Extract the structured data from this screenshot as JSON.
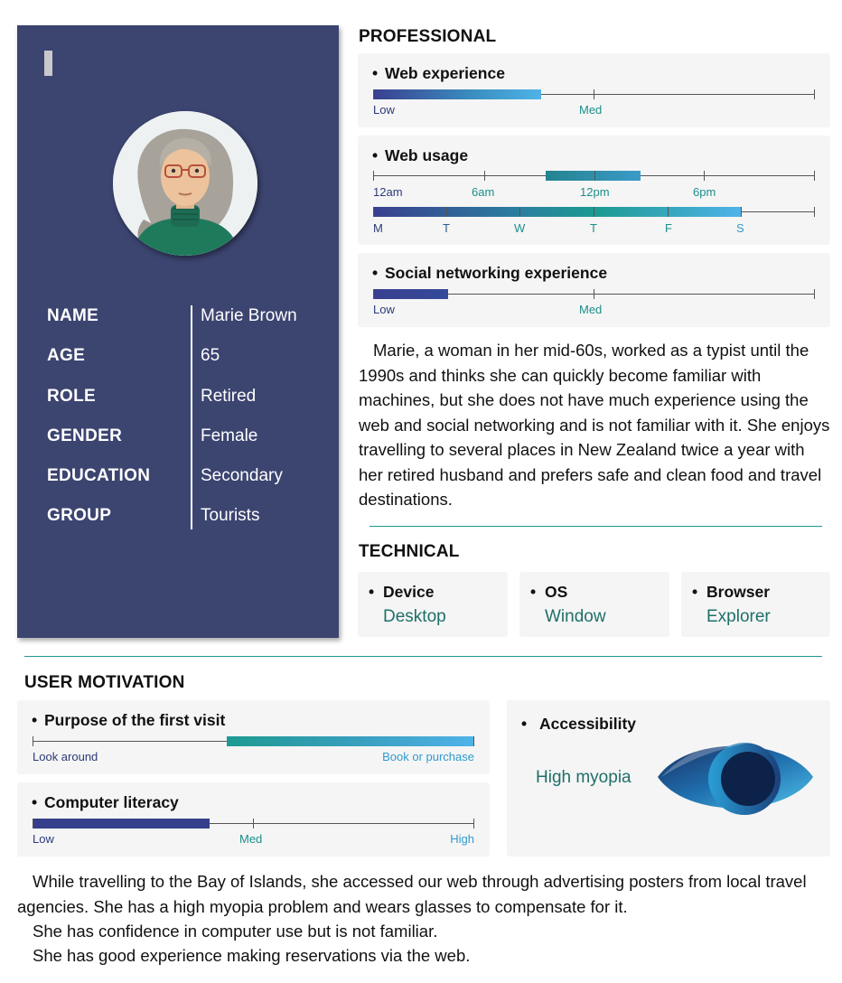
{
  "profile": {
    "fields": [
      {
        "label": "NAME",
        "value": "Marie Brown"
      },
      {
        "label": "AGE",
        "value": "65"
      },
      {
        "label": "ROLE",
        "value": "Retired"
      },
      {
        "label": "GENDER",
        "value": "Female"
      },
      {
        "label": "EDUCATION",
        "value": "Secondary"
      },
      {
        "label": "GROUP",
        "value": "Tourists"
      }
    ]
  },
  "professional": {
    "title": "PROFESSIONAL",
    "web_experience": {
      "bullet": "•",
      "title": "Web experience",
      "labels": [
        "Low",
        "Med"
      ],
      "level": 0.38
    },
    "web_usage": {
      "bullet": "•",
      "title": "Web usage",
      "time_labels": [
        "12am",
        "6am",
        "12pm",
        "6pm"
      ],
      "time_range": [
        "10am",
        "3pm"
      ],
      "day_labels": [
        "M",
        "T",
        "W",
        "T",
        "F",
        "S"
      ],
      "day_range": [
        "M",
        "S"
      ]
    },
    "social": {
      "bullet": "•",
      "title": "Social networking experience",
      "labels": [
        "Low",
        "Med"
      ],
      "level": 0.17
    },
    "description": "Marie, a woman in her mid-60s, worked as a typist until the 1990s and thinks she can quickly become familiar with machines, but she does not have much experience using the web and social networking and is not familiar with it. She enjoys travelling to several places in New Zealand twice a year with her retired husband and prefers safe and clean food and travel destinations."
  },
  "technical": {
    "title": "TECHNICAL",
    "items": [
      {
        "bullet": "•",
        "label": "Device",
        "value": "Desktop"
      },
      {
        "bullet": "•",
        "label": "OS",
        "value": "Window"
      },
      {
        "bullet": "•",
        "label": "Browser",
        "value": "Explorer"
      }
    ]
  },
  "motivation": {
    "title": "USER MOTIVATION",
    "purpose": {
      "bullet": "•",
      "title": "Purpose of the first visit",
      "left_label": "Look around",
      "right_label": "Book or purchase",
      "level_start": 0.44
    },
    "literacy": {
      "bullet": "•",
      "title": "Computer literacy",
      "labels": [
        "Low",
        "Med",
        "High"
      ],
      "level": 0.4
    },
    "accessibility": {
      "bullet": "•",
      "title": "Accessibility",
      "value": "High myopia",
      "icon": "eye-icon"
    }
  },
  "summary": {
    "lines": [
      "While travelling to the Bay of Islands, she accessed our web through advertising posters from local travel agencies. She has a high myopia problem and wears glasses to compensate for it.",
      "She has confidence in computer use but is not familiar.",
      "She has good experience making reservations via the web."
    ]
  },
  "colors": {
    "card": "#3c4470",
    "navy": "#3a3f8f",
    "teal": "#1d9a91",
    "sky": "#4fb3e8"
  }
}
